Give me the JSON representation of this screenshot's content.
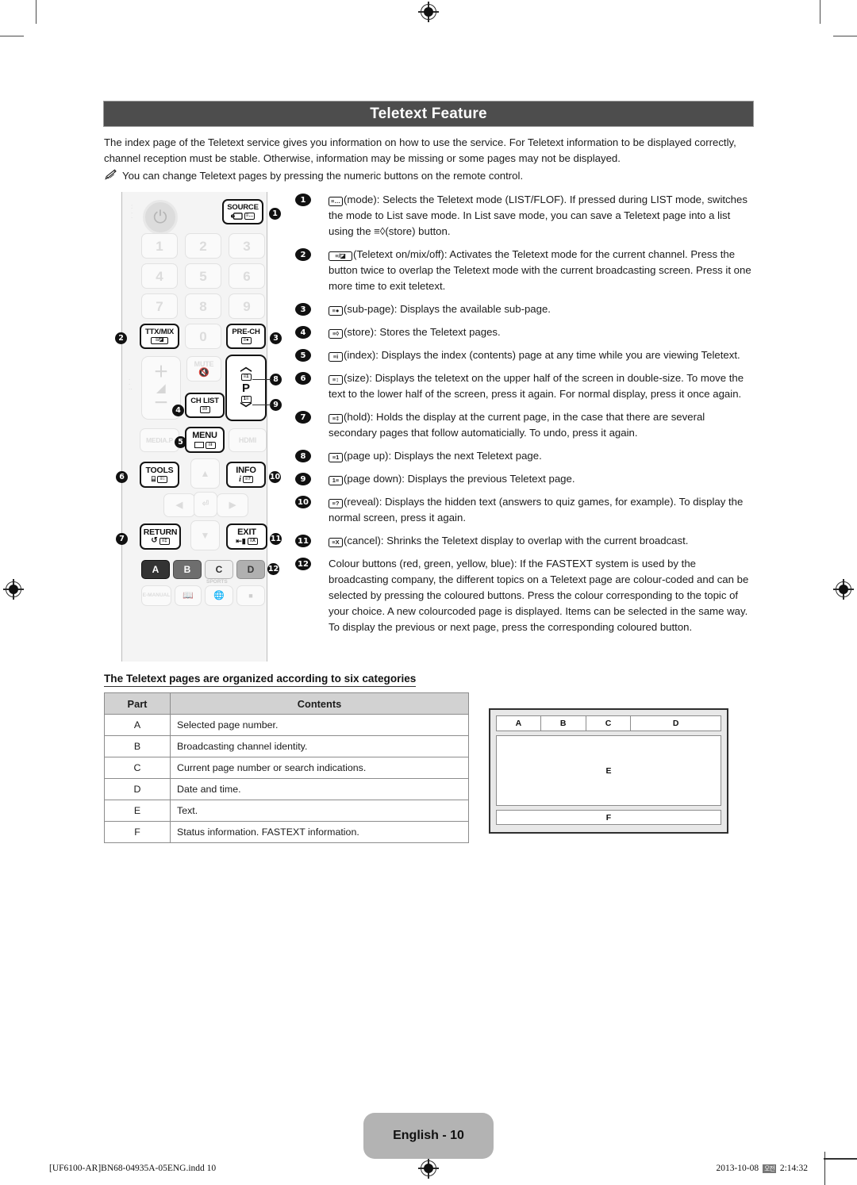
{
  "document": {
    "title": "Teletext Feature",
    "intro": "The index page of the Teletext service gives you information on how to use the service. For Teletext information to be displayed correctly, channel reception must be stable. Otherwise, information may be missing or some pages may not be displayed.",
    "note": "You can change Teletext pages by pressing the numeric buttons on the remote control.",
    "note_icon": "pencil-note-icon"
  },
  "descriptions": [
    {
      "num": "1",
      "symbol": "≡…",
      "text": "(mode): Selects the Teletext mode (LIST/FLOF). If pressed during LIST mode, switches the mode to List save mode. In List save mode, you can save a Teletext page into a list using the ≡◊(store) button."
    },
    {
      "num": "2",
      "symbol": "≡/◪",
      "text": "(Teletext on/mix/off): Activates the Teletext mode for the current channel. Press the button twice to overlap the Teletext mode with the current broadcasting screen. Press it one more time to exit teletext."
    },
    {
      "num": "3",
      "symbol": "≡●",
      "text": "(sub-page): Displays the available sub-page."
    },
    {
      "num": "4",
      "symbol": "≡◊",
      "text": "(store): Stores the Teletext pages."
    },
    {
      "num": "5",
      "symbol": "≡i",
      "text": "(index): Displays the index (contents) page at any time while you are viewing Teletext."
    },
    {
      "num": "6",
      "symbol": "≡↕",
      "text": "(size): Displays the teletext on the upper half of the screen in double-size. To move the text to the lower half of the screen, press it again. For normal display, press it once again."
    },
    {
      "num": "7",
      "symbol": "≡‡",
      "text": "(hold): Holds the display at the current page, in the case that there are several secondary pages that follow automaticially. To undo, press it again."
    },
    {
      "num": "8",
      "symbol": "≡1",
      "text": "(page up): Displays the next Teletext page."
    },
    {
      "num": "9",
      "symbol": "1≡",
      "text": "(page down): Displays the previous Teletext page."
    },
    {
      "num": "10",
      "symbol": "≡?",
      "text": "(reveal): Displays the hidden text (answers to quiz games, for example). To display the normal screen, press it again."
    },
    {
      "num": "11",
      "symbol": "≡X",
      "text": "(cancel): Shrinks the Teletext display to overlap with the current broadcast."
    },
    {
      "num": "12",
      "symbol": "",
      "text": "Colour buttons (red, green, yellow, blue): If the FASTEXT system is used by the broadcasting company, the different topics on a Teletext page are colour-coded and can be selected by pressing the coloured buttons. Press the colour corresponding to the topic of your choice. A new colourcoded page is displayed. Items can be selected in the same way. To display the previous or next page, press the corresponding coloured button."
    }
  ],
  "remote": {
    "power": "power-icon",
    "keys": {
      "source": "SOURCE",
      "n1": "1",
      "n2": "2",
      "n3": "3",
      "n4": "4",
      "n5": "5",
      "n6": "6",
      "n7": "7",
      "n8": "8",
      "n9": "9",
      "ttxmix": "TTX/MIX",
      "n0": "0",
      "prech": "PRE-CH",
      "mute": "MUTE",
      "chlist": "CH LIST",
      "p": "P",
      "media": "MEDIA.P",
      "menu": "MENU",
      "hdmi": "HDMI",
      "tools": "TOOLS",
      "info": "INFO",
      "return": "RETURN",
      "exit": "EXIT",
      "colour_a": "A",
      "colour_b": "B",
      "colour_c": "C",
      "colour_d": "D",
      "sports_label": "SPORTS",
      "emanual": "E-MANUAL"
    },
    "key_glyphs": {
      "source": "≡…",
      "ttxmix": "≡/◪",
      "prech": "≡●",
      "chlist": "≡◊",
      "p_up": "≡1",
      "p_down": "1≡",
      "menu": "≡i",
      "tools": "≡↕",
      "info": "≡?",
      "return": "≡‡",
      "exit": "≡X"
    },
    "callouts": [
      "1",
      "2",
      "3",
      "4",
      "5",
      "6",
      "7",
      "8",
      "9",
      "10",
      "11",
      "12"
    ]
  },
  "categories": {
    "heading": "The Teletext pages are organized according to six categories",
    "columns": [
      "Part",
      "Contents"
    ],
    "rows": [
      {
        "part": "A",
        "contents": "Selected page number."
      },
      {
        "part": "B",
        "contents": "Broadcasting channel identity."
      },
      {
        "part": "C",
        "contents": "Current page number or search indications."
      },
      {
        "part": "D",
        "contents": "Date and time."
      },
      {
        "part": "E",
        "contents": "Text."
      },
      {
        "part": "F",
        "contents": "Status information. FASTEXT information."
      }
    ]
  },
  "diagram": {
    "top_cells": [
      "A",
      "B",
      "C",
      "D"
    ],
    "middle_cell": "E",
    "bottom_cell": "F"
  },
  "footer": {
    "page_badge": "English - 10",
    "file_info": "[UF6100-AR]BN68-04935A-05ENG.indd   10",
    "date": "2013-10-08",
    "cjk": "오전",
    "time": "2:14:32"
  },
  "colors": {
    "banner_bg": "#4d4d4d",
    "table_header_bg": "#d2d2d2",
    "page_badge_bg": "#b3b3b3",
    "colour_a": "#333333",
    "colour_b": "#6e6e6e",
    "colour_c": "#efefef",
    "colour_d": "#b0b0b0"
  }
}
